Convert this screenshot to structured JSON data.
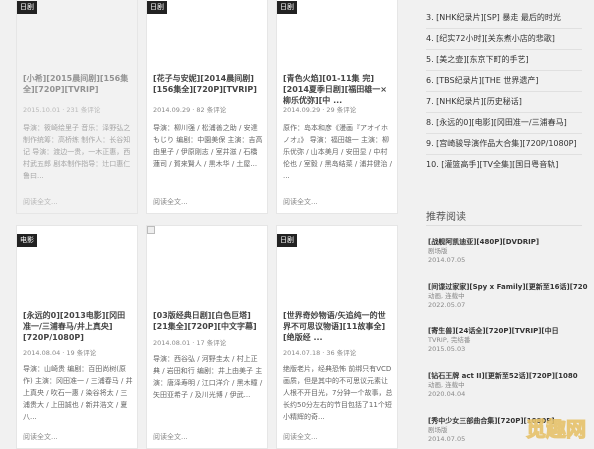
{
  "cards": [
    {
      "badge": "日剧",
      "title": "[小希][2015晨间剧][156集全][720P][TVRIP]",
      "meta": "2015.10.01 · 231 条评论",
      "desc": "导演：筱崎绘里子 音乐：泽野弘之 制作统筹：高桥练 制作人：长谷知记 导演：渡边一贵，一木正惠，西村武五郎 剧本制作指导：辻口惠仁 鲁曰...",
      "more": "阅读全文..."
    },
    {
      "badge": "日剧",
      "title": "[花子与安妮][2014晨间剧][156集全][720P][TVRIP]",
      "meta": "2014.09.29 · 82 条评论",
      "desc": "导演：柳川强 / 松浦善之助 / 安達もじり 编剧：中園美保 主演：吉高由里子 / 伊原刚志 / 室井滋 / 石橋蓮司 / 賀来賢人 / 黒木华 / 土屋...",
      "more": "阅读全文..."
    },
    {
      "badge": "日剧",
      "title": "[青色火焰][01-11集 完][2014夏季日剧][福田雄一×柳乐优弥][中 ...",
      "meta": "2014.09.29 · 29 条评论",
      "desc": "原作：岛本和彦《漫画『アオイホノオ』》 导演：福田雄一 主演：柳乐优弥 / 山本美月 / 安田显 / 中村伦也 / 室毅 / 黑岛结菜 / 浦井健治 / ...",
      "more": "阅读全文..."
    },
    {
      "badge": "电影",
      "title": "[永远的0][2013电影][冈田准一/三浦春马/井上真央][720P/1080P]",
      "meta": "2014.08.04 · 19 条评论",
      "desc": "导演：山崎贵 编剧：百田尚树(原作) 主演：冈田准一 / 三浦春马 / 井上真央 / 吹石一惠 / 染谷将太 / 三浦贵大 / 上田誠也 / 新井浩文 / 夏八...",
      "more": "阅读全文..."
    },
    {
      "badge": "",
      "title": "[03版经典日剧][白色巨塔][21集全][720P][中文字幕]",
      "meta": "2014.08.01 · 17 条评论",
      "desc": "导演：西谷弘 / 河野圭太 / 村上正典 / 岩田和行 编剧：井上由美子 主演：唐泽寿明 / 江口洋介 / 黑木瞳 / 矢田亚希子 / 及川光博 / 伊武...",
      "more": "阅读全文..."
    },
    {
      "badge": "日剧",
      "title": "[世界奇妙物语/矢追纯一的世界不可思议物语][11故事全][绝版经 ...",
      "meta": "2014.07.18 · 36 条评论",
      "desc": "绝版老片，经典恐怖 前绑只有VCD画质，但是其中的不可思议元素让人根不开目光，7分钟一个故事，总长约50分左右的节目包括了11个短小精辉的奇...",
      "more": "阅读全文..."
    }
  ],
  "sidebar": {
    "ranking": [
      "3. [NHK纪录片][SP] 暴走 最后的时光",
      "4. [纪实72小时][关东煮小店的悲歌]",
      "5. [美之壶][东京下町的手艺]",
      "6. [TBS纪录片][THE 世界遗产]",
      "7. [NHK纪录片][历史秘话]",
      "8. [永远的0][电影][冈田准一/三浦春马]",
      "9. [宫崎骏导演作品大合集][720P/1080P]",
      "10. [灌篮高手][TV全集][国日粤音轨]"
    ],
    "heading": "推荐阅读",
    "recommended": [
      {
        "title": "[战舰阿凯迪亚][480P][DVDRIP]",
        "category": "剧场版",
        "date": "2014.07.05"
      },
      {
        "title": "[间谍过家家][Spy x Family][更新至16话][720",
        "category": "动画, 连载中",
        "date": "2022.05.07"
      },
      {
        "title": "[寄生兽][24话全][720P][TVRIP][中日",
        "category": "TVRIP, 完结番",
        "date": "2015.05.03"
      },
      {
        "title": "[钻石王牌 act II][更新至52话][720P][1080",
        "category": "动画, 连载中",
        "date": "2020.04.04"
      },
      {
        "title": "[秀中少女三部曲合集][720P][1080P]",
        "category": "剧场版",
        "date": "2014.07.05"
      }
    ]
  },
  "watermark": "觅趣网"
}
